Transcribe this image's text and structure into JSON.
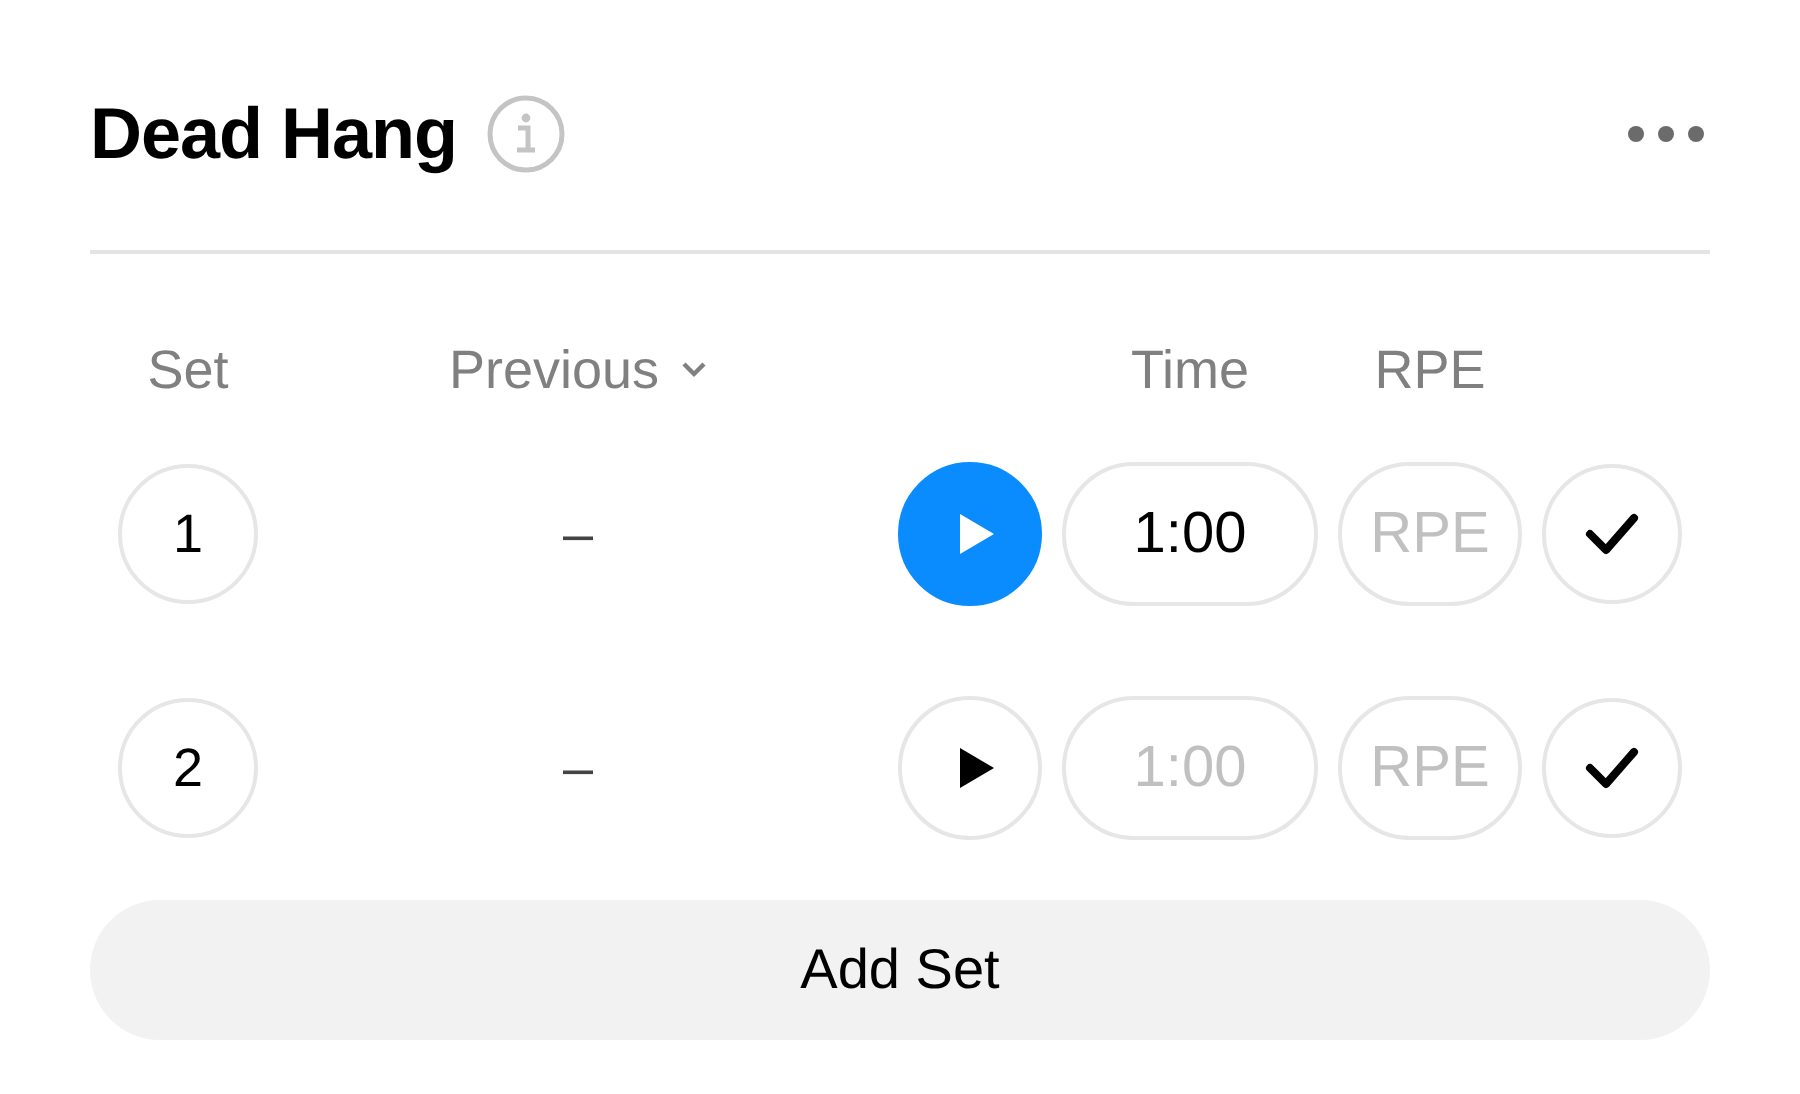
{
  "exercise": {
    "title": "Dead Hang"
  },
  "columns": {
    "set": "Set",
    "previous": "Previous",
    "time": "Time",
    "rpe": "RPE"
  },
  "sets": [
    {
      "set": "1",
      "previous": "–",
      "timer_running": true,
      "time": {
        "value": "1:00"
      },
      "rpe": {
        "placeholder": "RPE"
      }
    },
    {
      "set": "2",
      "previous": "–",
      "timer_running": false,
      "time": {
        "placeholder": "1:00"
      },
      "rpe": {
        "placeholder": "RPE"
      }
    }
  ],
  "add_button": "Add Set"
}
